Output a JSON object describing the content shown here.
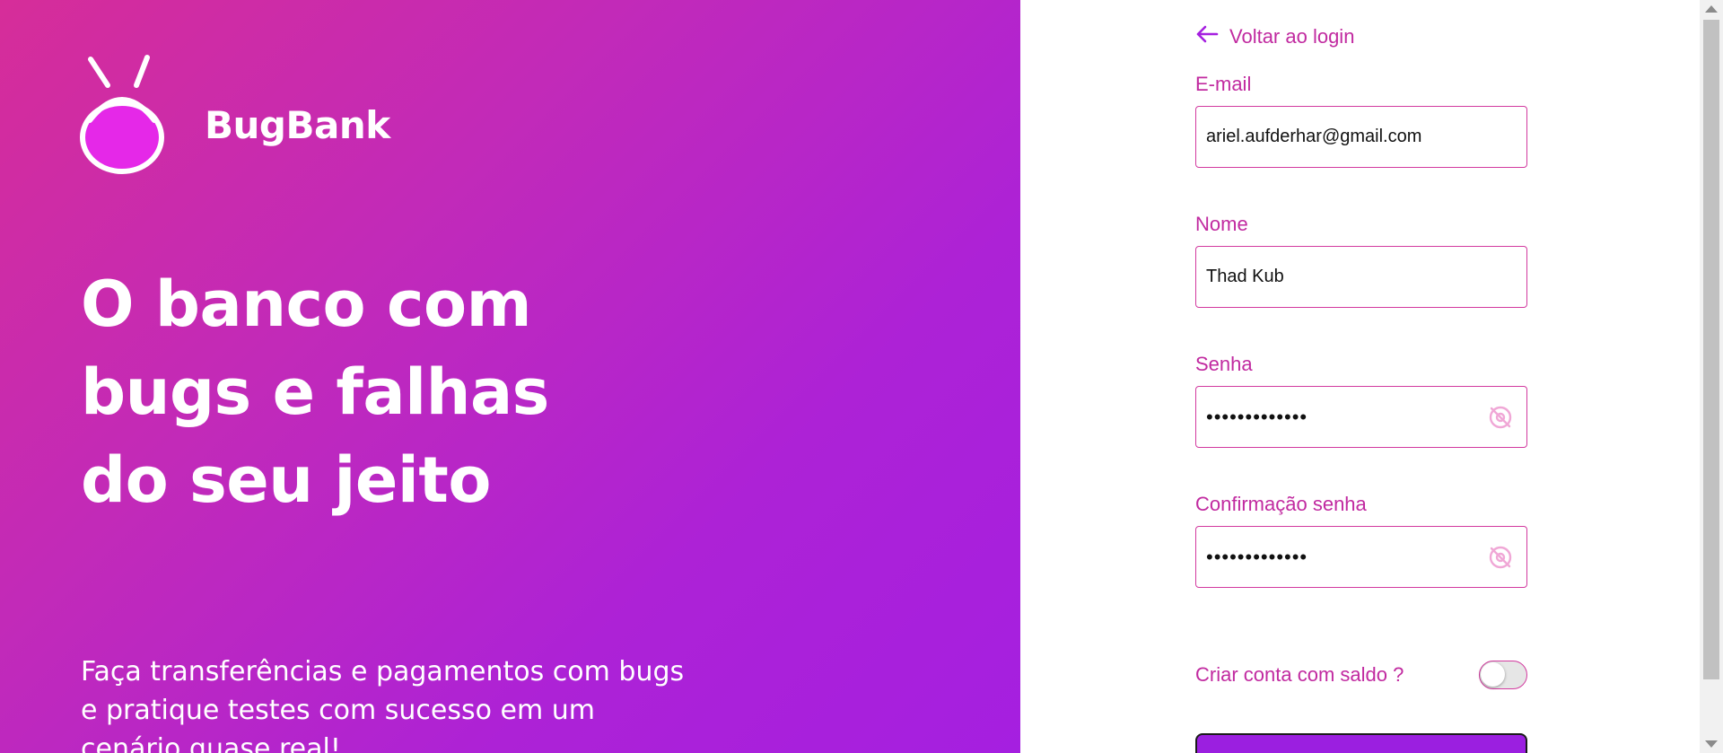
{
  "brand": {
    "name": "BugBank",
    "logo_icon": "bug-logo-icon"
  },
  "hero": {
    "headline_lines": [
      "O banco com",
      "bugs e falhas",
      "do seu jeito"
    ],
    "subtext": "Faça transferências e pagamentos com bugs e pratique testes com sucesso em um cenário quase real!"
  },
  "form": {
    "back_link": {
      "label": "Voltar ao login",
      "icon": "arrow-left-icon"
    },
    "email": {
      "label": "E-mail",
      "value": "ariel.aufderhar@gmail.com"
    },
    "name": {
      "label": "Nome",
      "value": "Thad Kub"
    },
    "password": {
      "label": "Senha",
      "value": "•••••••••••••",
      "icon": "eye-off-icon"
    },
    "password_confirm": {
      "label": "Confirmação senha",
      "value": "•••••••••••••",
      "icon": "eye-off-icon"
    },
    "balance_toggle": {
      "label": "Criar conta com saldo ?",
      "on": false
    }
  },
  "colors": {
    "accent": "#c12aa0",
    "border": "#d23a9f",
    "hero_start": "#d62d99",
    "hero_end": "#a51fe0",
    "button": "#9b1fe0"
  }
}
